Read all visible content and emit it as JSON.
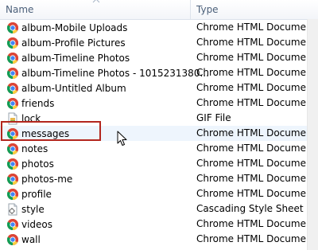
{
  "columns": {
    "name": "Name",
    "type": "Type"
  },
  "files": [
    {
      "name": "album-Mobile Uploads",
      "type": "Chrome HTML Document",
      "icon": "chrome-icon"
    },
    {
      "name": "album-Profile Pictures",
      "type": "Chrome HTML Document",
      "icon": "chrome-icon"
    },
    {
      "name": "album-Timeline Photos",
      "type": "Chrome HTML Document",
      "icon": "chrome-icon"
    },
    {
      "name": "album-Timeline Photos - 1015231380...",
      "type": "Chrome HTML Document",
      "icon": "chrome-icon"
    },
    {
      "name": "album-Untitled Album",
      "type": "Chrome HTML Document",
      "icon": "chrome-icon"
    },
    {
      "name": "friends",
      "type": "Chrome HTML Document",
      "icon": "chrome-icon"
    },
    {
      "name": "lock",
      "type": "GIF File",
      "icon": "gif-file-icon"
    },
    {
      "name": "messages",
      "type": "Chrome HTML Document",
      "icon": "chrome-icon"
    },
    {
      "name": "notes",
      "type": "Chrome HTML Document",
      "icon": "chrome-icon"
    },
    {
      "name": "photos",
      "type": "Chrome HTML Document",
      "icon": "chrome-icon"
    },
    {
      "name": "photos-me",
      "type": "Chrome HTML Document",
      "icon": "chrome-icon"
    },
    {
      "name": "profile",
      "type": "Chrome HTML Document",
      "icon": "chrome-icon"
    },
    {
      "name": "style",
      "type": "Cascading Style Sheet Do...",
      "icon": "css-file-icon"
    },
    {
      "name": "videos",
      "type": "Chrome HTML Document",
      "icon": "chrome-icon"
    },
    {
      "name": "wall",
      "type": "Chrome HTML Document",
      "icon": "chrome-icon"
    }
  ],
  "highlighted_row": "messages",
  "colors": {
    "highlight_border": "#b3261e",
    "hover_row": "#eef5fd",
    "header_text": "#4c607a"
  }
}
